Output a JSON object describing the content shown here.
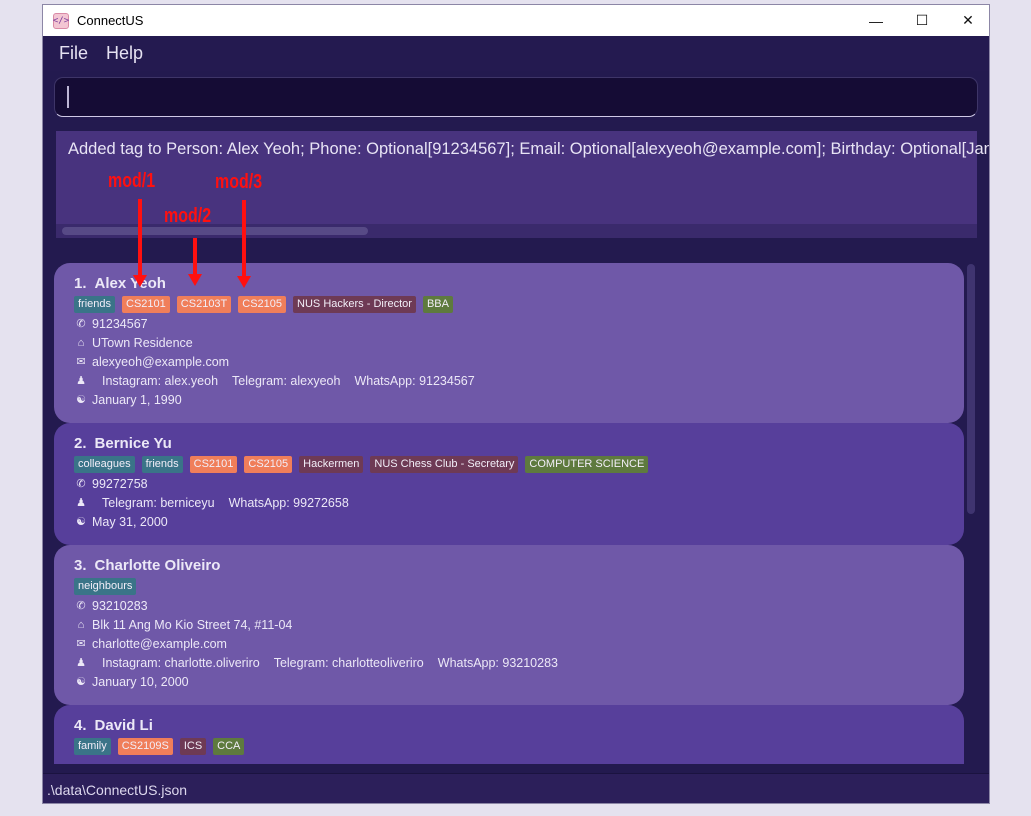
{
  "window": {
    "title": "ConnectUS",
    "app_icon": "code-brackets-icon",
    "controls": [
      "minimize-icon",
      "maximize-icon",
      "close-icon"
    ]
  },
  "menu": [
    "File",
    "Help"
  ],
  "command": {
    "value": "",
    "placeholder": ""
  },
  "result": "Added tag to Person: Alex Yeoh; Phone: Optional[91234567]; Email: Optional[alexyeoh@example.com]; Birthday: Optional[Jan",
  "annotations": [
    "mod/1",
    "mod/2",
    "mod/3"
  ],
  "tag_colors": {
    "general": "#3a7488",
    "module": "#f07e5a",
    "cca": "#6e3a55",
    "major": "#5e7a3e"
  },
  "persons": [
    {
      "index": "1.",
      "name": "Alex Yeoh",
      "tags": [
        [
          "friends",
          "general"
        ],
        [
          "CS2101",
          "module"
        ],
        [
          "CS2103T",
          "module"
        ],
        [
          "CS2105",
          "module"
        ],
        [
          "NUS Hackers - Director",
          "cca"
        ],
        [
          "BBA",
          "major"
        ]
      ],
      "phone": "91234567",
      "address": "UTown Residence",
      "email": "alexyeoh@example.com",
      "socials": [
        "Instagram: alex.yeoh",
        "Telegram: alexyeoh",
        "WhatsApp: 91234567"
      ],
      "birthday": "January 1, 1990"
    },
    {
      "index": "2.",
      "name": "Bernice Yu",
      "tags": [
        [
          "colleagues",
          "general"
        ],
        [
          "friends",
          "general"
        ],
        [
          "CS2101",
          "module"
        ],
        [
          "CS2105",
          "module"
        ],
        [
          "Hackermen",
          "cca"
        ],
        [
          "NUS Chess Club - Secretary",
          "cca"
        ],
        [
          "COMPUTER SCIENCE",
          "major"
        ]
      ],
      "phone": "99272758",
      "socials": [
        "Telegram: berniceyu",
        "WhatsApp: 99272658"
      ],
      "birthday": "May 31, 2000"
    },
    {
      "index": "3.",
      "name": "Charlotte Oliveiro",
      "tags": [
        [
          "neighbours",
          "general"
        ]
      ],
      "phone": "93210283",
      "address": "Blk 11 Ang Mo Kio Street 74, #11-04",
      "email": "charlotte@example.com",
      "socials": [
        "Instagram: charlotte.oliveriro",
        "Telegram: charlotteoliveriro",
        "WhatsApp: 93210283"
      ],
      "birthday": "January 10, 2000"
    },
    {
      "index": "4.",
      "name": "David Li",
      "tags": [
        [
          "family",
          "general"
        ],
        [
          "CS2109S",
          "module"
        ],
        [
          "ICS",
          "cca"
        ],
        [
          "CCA",
          "major"
        ]
      ]
    }
  ],
  "status": ".\\data\\ConnectUS.json"
}
